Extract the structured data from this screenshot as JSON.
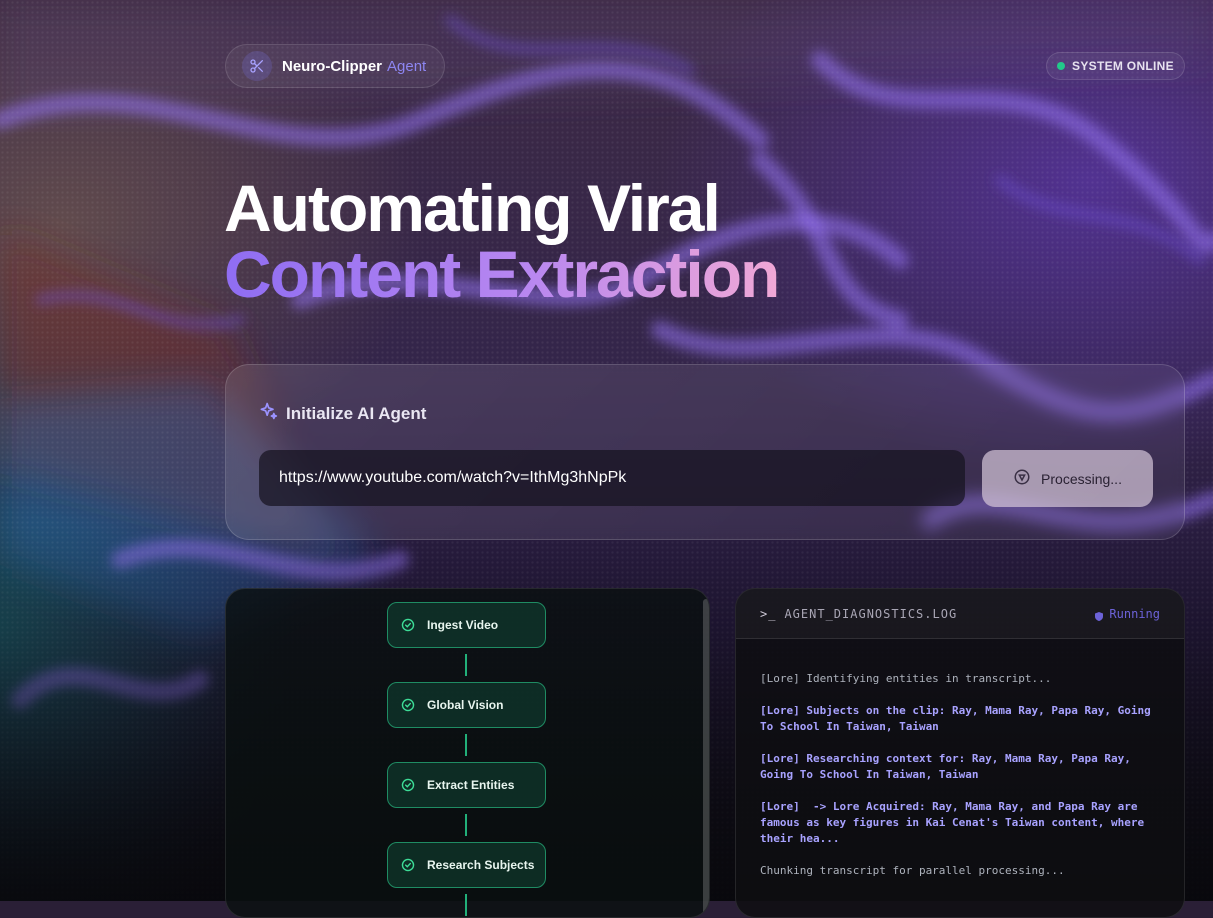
{
  "header": {
    "brand_name": "Neuro-Clipper",
    "brand_suffix": "Agent",
    "status": "SYSTEM ONLINE",
    "status_color": "#22c88a"
  },
  "hero": {
    "line1": "Automating Viral",
    "line2": "Content Extraction"
  },
  "init": {
    "title": "Initialize AI Agent",
    "url_value": "https://www.youtube.com/watch?v=IthMg3hNpPk",
    "button_label": "Processing..."
  },
  "pipeline": {
    "steps": [
      {
        "label": "Ingest Video",
        "done": true
      },
      {
        "label": "Global Vision",
        "done": true
      },
      {
        "label": "Extract Entities",
        "done": true
      },
      {
        "label": "Research Subjects",
        "done": true
      }
    ]
  },
  "log": {
    "title": "AGENT_DIAGNOSTICS.LOG",
    "prompt": ">_",
    "state": "Running",
    "lines": [
      {
        "text": "[Lore] Identifying entities in transcript...",
        "kind": "info"
      },
      {
        "text": "[Lore] Subjects on the clip: Ray, Mama Ray, Papa Ray, Going To School In Taiwan, Taiwan",
        "kind": "hi"
      },
      {
        "text": "[Lore] Researching context for: Ray, Mama Ray, Papa Ray, Going To School In Taiwan, Taiwan",
        "kind": "hi"
      },
      {
        "text": "[Lore]  -> Lore Acquired: Ray, Mama Ray, and Papa Ray are famous as key figures in Kai Cenat's Taiwan content, where their hea...",
        "kind": "hi"
      },
      {
        "text": "Chunking transcript for parallel processing...",
        "kind": "info"
      }
    ]
  }
}
